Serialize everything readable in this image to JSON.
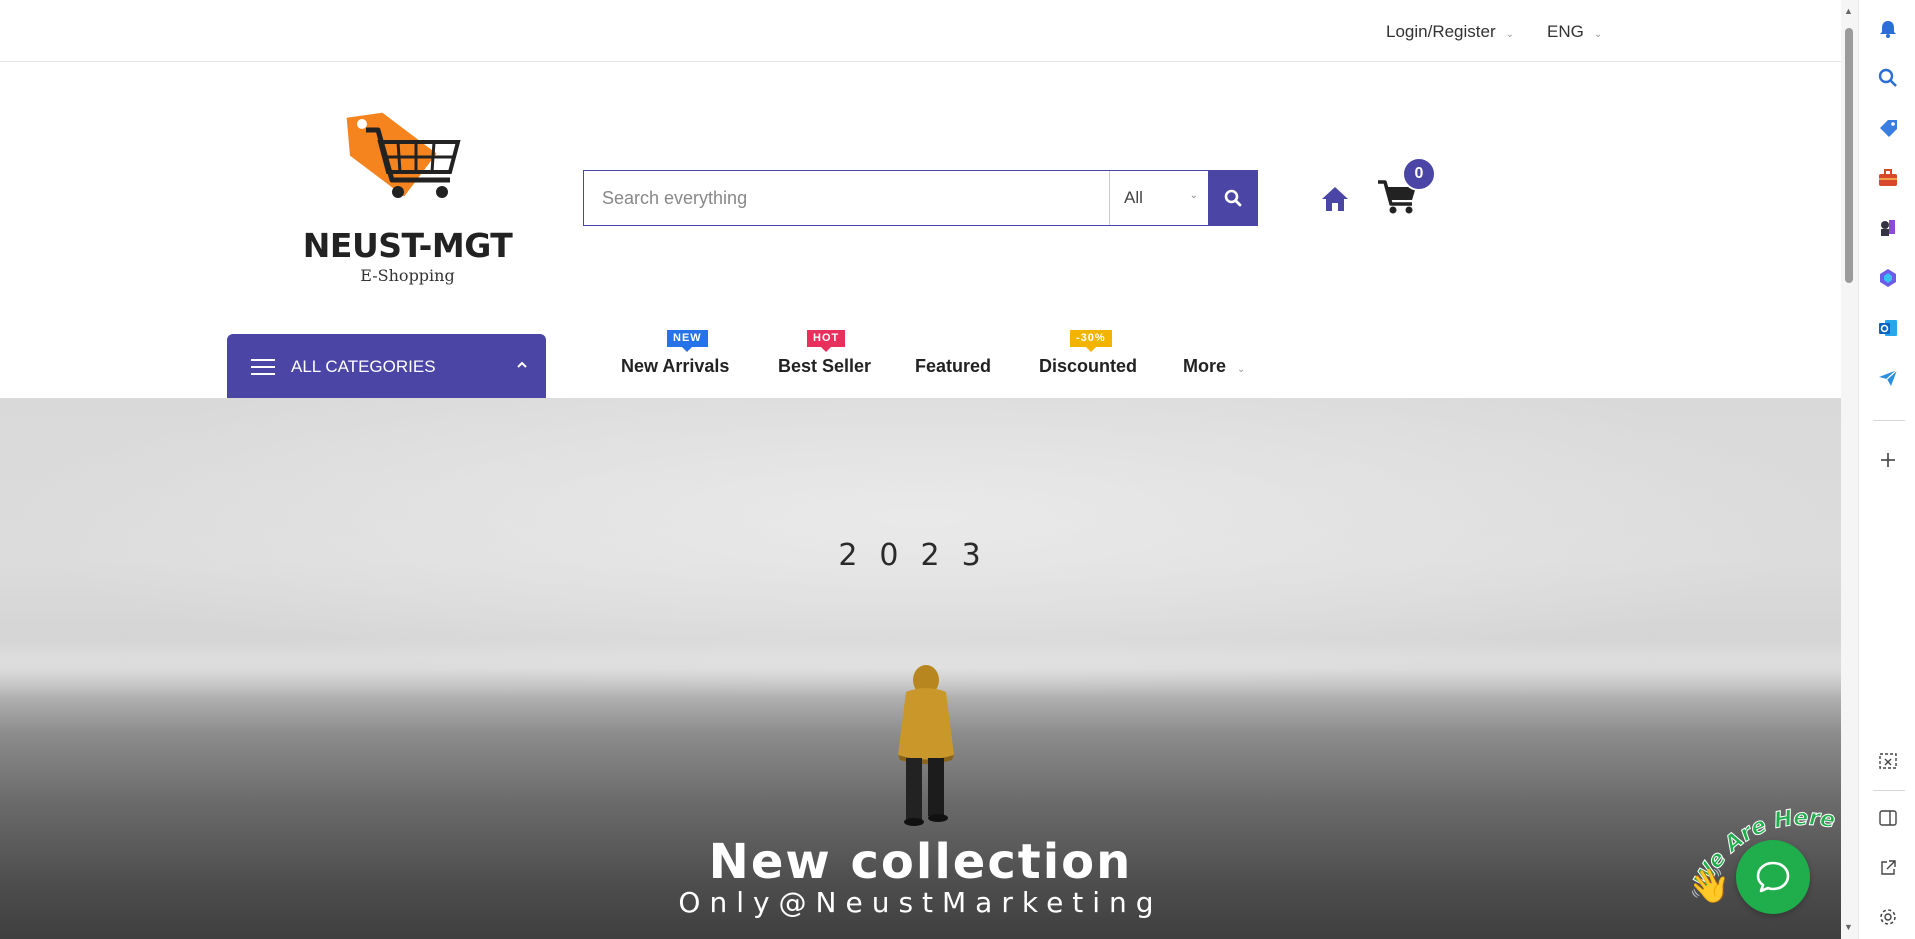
{
  "topbar": {
    "login_label": "Login/Register",
    "language_label": "ENG"
  },
  "logo": {
    "name": "NEUST-MGT",
    "subtitle": "E-Shopping"
  },
  "search": {
    "placeholder": "Search everything",
    "value": "",
    "category_selected": "All"
  },
  "cart": {
    "count": "0"
  },
  "categories": {
    "label": "ALL CATEGORIES"
  },
  "nav": {
    "items": [
      {
        "label": "New Arrivals",
        "badge": "NEW"
      },
      {
        "label": "Best Seller",
        "badge": "HOT"
      },
      {
        "label": "Featured",
        "badge": ""
      },
      {
        "label": "Discounted",
        "badge": "-30%"
      },
      {
        "label": "More",
        "badge": ""
      }
    ]
  },
  "hero": {
    "year": "2023",
    "title": "New collection",
    "subtitle": "Only@NeustMarketing"
  },
  "chat": {
    "tagline": "We Are Here!"
  },
  "colors": {
    "accent": "#4b46a6",
    "badge_new": "#2573e8",
    "badge_hot": "#e8305c",
    "badge_discount": "#f3b400",
    "chat_green": "#1fae4b",
    "logo_orange": "#f5841f"
  },
  "sidebar_icons": [
    "bell-icon",
    "search-icon",
    "tag-icon",
    "toolbox-icon",
    "chess-icon",
    "copilot-icon",
    "outlook-icon",
    "send-icon",
    "plus-icon",
    "screenshot-icon",
    "split-view-icon",
    "external-link-icon",
    "settings-icon"
  ]
}
